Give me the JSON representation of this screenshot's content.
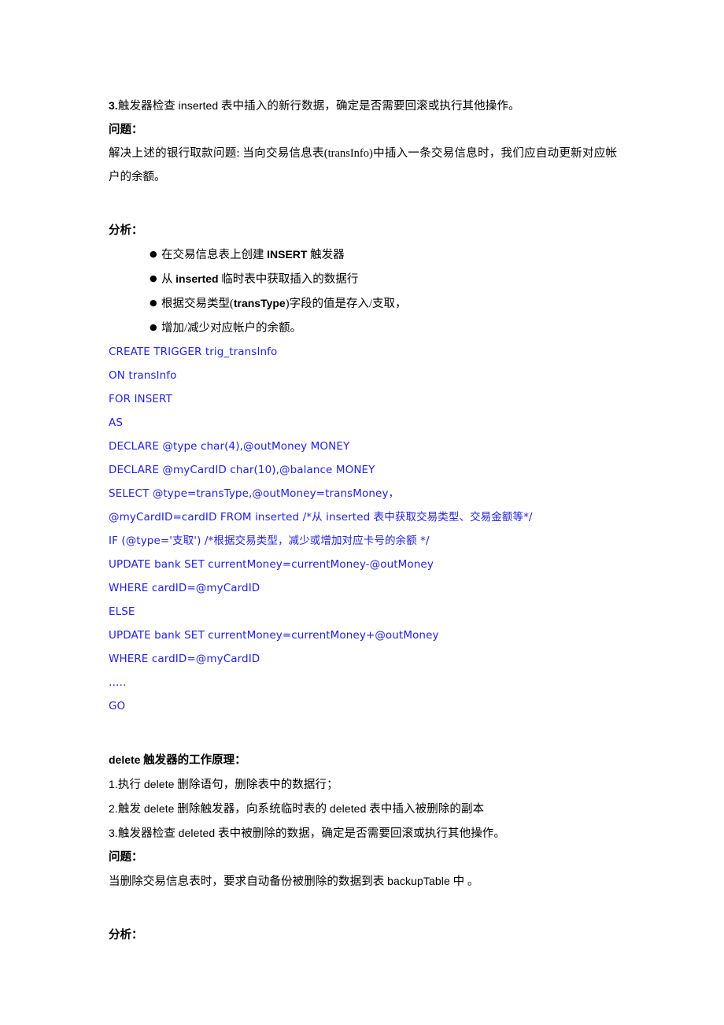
{
  "document": {
    "insert_trigger_step3": {
      "prefix": "3.",
      "text_a": "触发器检查 ",
      "code_a": "inserted",
      "text_b": " 表中插入的新行数据，确定是否需要回滚或执行其他操作。"
    },
    "problem_heading_1": "问题：",
    "problem_text_1": "解决上述的银行取款问题: 当向交易信息表(transInfo)中插入一条交易信息时，我们应自动更新对应帐户的余额。",
    "analysis_heading_1": "分析：",
    "bullets": [
      {
        "before": "在交易信息表上创建 ",
        "strong": "INSERT",
        "after": " 触发器"
      },
      {
        "before": "从 ",
        "strong": "inserted",
        "after": " 临时表中获取插入的数据行"
      },
      {
        "before": "根据交易类型(",
        "strong": "transType",
        "after": ")字段的值是存入/支取，"
      },
      {
        "before": "增加/减少对应帐户的余额。",
        "strong": "",
        "after": ""
      }
    ],
    "sql_lines": [
      "CREATE TRIGGER trig_transInfo",
      "ON transInfo",
      "FOR INSERT",
      "AS",
      "DECLARE @type char(4),@outMoney MONEY",
      "DECLARE @myCardID char(10),@balance MONEY",
      "SELECT @type=transType,@outMoney=transMoney，",
      "@myCardID=cardID FROM inserted /*从 inserted 表中获取交易类型、交易金额等*/",
      "IF (@type='支取') /*根据交易类型，减少或增加对应卡号的余额 */",
      "UPDATE bank SET currentMoney=currentMoney-@outMoney",
      "WHERE cardID=@myCardID",
      "ELSE",
      "UPDATE bank SET currentMoney=currentMoney+@outMoney",
      "WHERE cardID=@myCardID",
      "…..",
      "GO"
    ],
    "delete_section": {
      "heading_code": "delete",
      "heading_text": " 触发器的工作原理：",
      "steps": [
        {
          "prefix": "1.",
          "text_a": "执行 ",
          "code_a": "delete",
          "text_b": " 删除语句，删除表中的数据行；",
          "code_b": "",
          "text_c": ""
        },
        {
          "prefix": "2.",
          "text_a": "触发 ",
          "code_a": "delete",
          "text_b": " 删除触发器，向系统临时表的 ",
          "code_b": "deleted",
          "text_c": " 表中插入被删除的副本"
        },
        {
          "prefix": "3.",
          "text_a": "触发器检查 ",
          "code_a": "deleted",
          "text_b": " 表中被删除的数据，确定是否需要回滚或执行其他操作。",
          "code_b": "",
          "text_c": ""
        }
      ],
      "problem_heading": "问题：",
      "problem_text_a": "当删除交易信息表时，要求自动备份被删除的数据到表 ",
      "problem_code": "backupTable",
      "problem_text_b": " 中 。",
      "analysis_heading": "分析："
    }
  },
  "colors": {
    "text": "#000000",
    "sql": "#2222dd",
    "background": "#ffffff"
  }
}
